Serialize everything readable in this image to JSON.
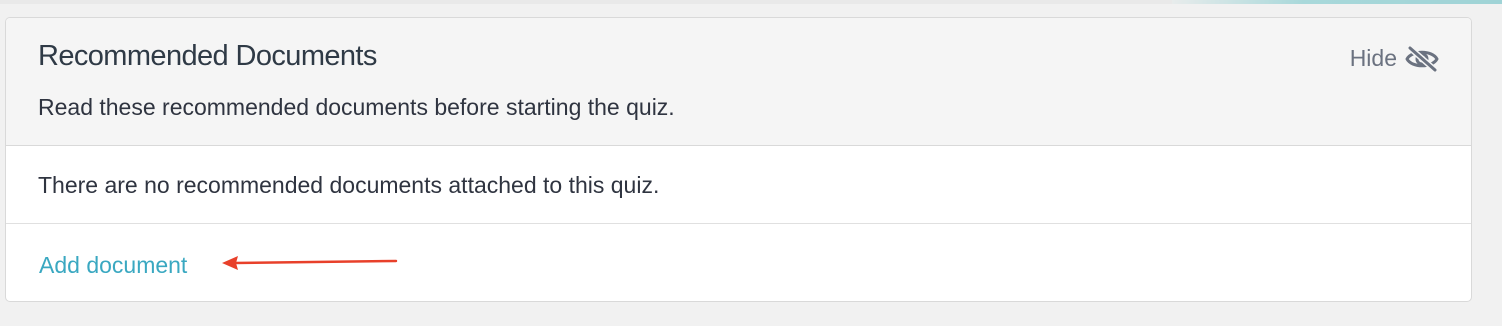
{
  "panel": {
    "title": "Recommended Documents",
    "subtitle": "Read these recommended documents before starting the quiz.",
    "hide_label": "Hide",
    "hide_icon": "eye-slash-icon",
    "empty_message": "There are no recommended documents attached to this quiz.",
    "add_link_label": "Add document"
  },
  "colors": {
    "link": "#3aa8c1",
    "annotation_arrow": "#e8402a",
    "header_bg": "#f5f5f5"
  }
}
